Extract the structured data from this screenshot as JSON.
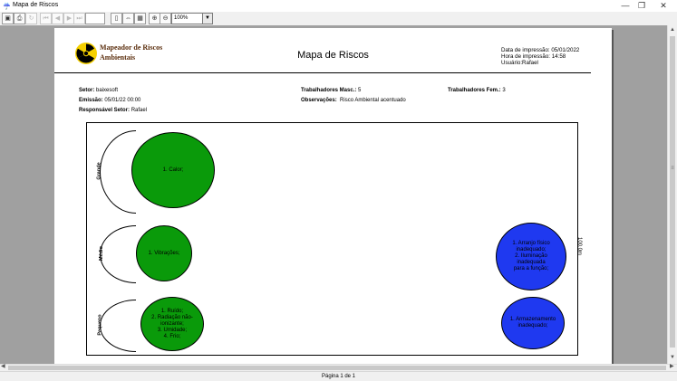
{
  "window": {
    "title": "Mapa de Riscos",
    "minimize_glyph": "—",
    "restore_glyph": "❐",
    "close_glyph": "✕"
  },
  "toolbar": {
    "zoom_value": "100%"
  },
  "report": {
    "logo_line1": "Mapeador de Riscos",
    "logo_line2": "Ambientais",
    "title": "Mapa de Riscos",
    "print_date": "Data de impressão: 05/01/2022",
    "print_time": "Hora de impressão: 14:58",
    "user": "Usuário:Rafael",
    "setor_label": "Setor:",
    "setor_value": "baixesoft",
    "emissao_label": "Emissão:",
    "emissao_value": "05/01/22 00:00",
    "responsavel_label": "Responsável Setor:",
    "responsavel_value": "Rafael",
    "masc_label": "Trabalhadores Masc.:",
    "masc_value": "5",
    "fem_label": "Trabalhadores Fem.:",
    "fem_value": "3",
    "obs_label": "Observações:",
    "obs_value": "Risco Ambiental acentuado",
    "scale_note": "100.0m"
  },
  "map": {
    "bands": [
      "Grande",
      "Médio",
      "Pequeno"
    ],
    "risks": {
      "grande_green": [
        "1. Calor;"
      ],
      "medio_green": [
        "1. Vibrações;"
      ],
      "pequeno_green": [
        "1. Ruído;",
        "2. Radiação não-",
        "ionizante;",
        "3. Umidade;",
        "4. Frio;"
      ],
      "medio_blue": [
        "1. Arranjo físico",
        "inadequado;",
        "2. Iluminação inadequada",
        "para a função;"
      ],
      "pequeno_blue": [
        "1. Armazenamento",
        "inadequado;"
      ]
    },
    "colors": {
      "physical": "#0a9a0a",
      "ergonomic": "#1f39f0"
    }
  },
  "status": {
    "page_text": "Página 1 de 1"
  }
}
